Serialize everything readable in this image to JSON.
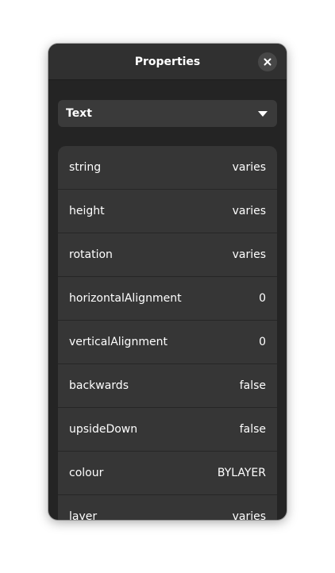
{
  "window": {
    "title": "Properties",
    "close_icon": "close-icon"
  },
  "dropdown": {
    "selected": "Text",
    "icon": "chevron-down-icon"
  },
  "properties": [
    {
      "key": "string",
      "value": "varies"
    },
    {
      "key": "height",
      "value": "varies"
    },
    {
      "key": "rotation",
      "value": "varies"
    },
    {
      "key": "horizontalAlignment",
      "value": "0"
    },
    {
      "key": "verticalAlignment",
      "value": "0"
    },
    {
      "key": "backwards",
      "value": "false"
    },
    {
      "key": "upsideDown",
      "value": "false"
    },
    {
      "key": "colour",
      "value": "BYLAYER"
    },
    {
      "key": "layer",
      "value": "varies"
    }
  ],
  "colors": {
    "window_bg": "#242424",
    "headerbar_bg": "#303030",
    "row_bg": "#363636",
    "text": "#ffffff"
  }
}
